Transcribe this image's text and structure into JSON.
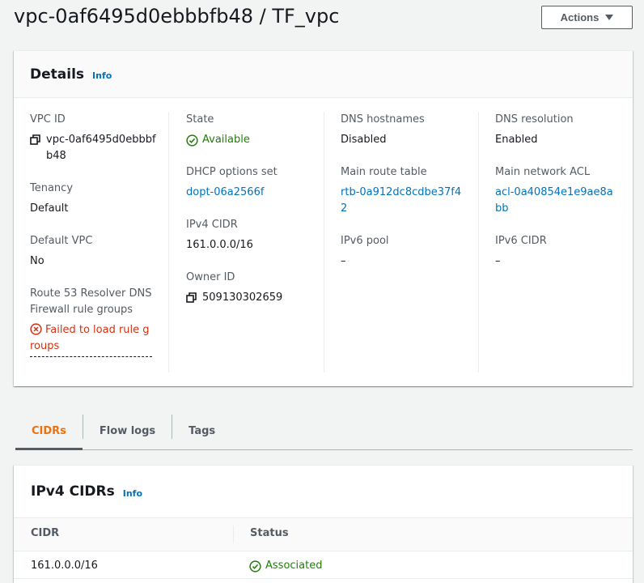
{
  "header": {
    "title": "vpc-0af6495d0ebbbfb48 / TF_vpc",
    "actions_label": "Actions"
  },
  "details": {
    "title": "Details",
    "info_label": "Info",
    "col1": {
      "vpc_id_label": "VPC ID",
      "vpc_id_value": "vpc-0af6495d0ebbbfb48",
      "tenancy_label": "Tenancy",
      "tenancy_value": "Default",
      "default_vpc_label": "Default VPC",
      "default_vpc_value": "No",
      "resolver_label": "Route 53 Resolver DNS Firewall rule groups",
      "resolver_value": "Failed to load rule groups"
    },
    "col2": {
      "state_label": "State",
      "state_value": "Available",
      "dhcp_label": "DHCP options set",
      "dhcp_value": "dopt-06a2566f",
      "ipv4_label": "IPv4 CIDR",
      "ipv4_value": "161.0.0.0/16",
      "owner_label": "Owner ID",
      "owner_value": "509130302659"
    },
    "col3": {
      "dns_hostnames_label": "DNS hostnames",
      "dns_hostnames_value": "Disabled",
      "route_table_label": "Main route table",
      "route_table_value": "rtb-0a912dc8cdbe37f42",
      "ipv6_pool_label": "IPv6 pool",
      "ipv6_pool_value": "–"
    },
    "col4": {
      "dns_resolution_label": "DNS resolution",
      "dns_resolution_value": "Enabled",
      "acl_label": "Main network ACL",
      "acl_value": "acl-0a40854e1e9ae8abb",
      "ipv6_cidr_label": "IPv6 CIDR",
      "ipv6_cidr_value": "–"
    }
  },
  "tabs": [
    {
      "label": "CIDRs"
    },
    {
      "label": "Flow logs"
    },
    {
      "label": "Tags"
    }
  ],
  "cidrs": {
    "title": "IPv4 CIDRs",
    "info_label": "Info",
    "columns": [
      "CIDR",
      "Status"
    ],
    "rows": [
      {
        "cidr": "161.0.0.0/16",
        "status": "Associated"
      }
    ]
  },
  "colors": {
    "link": "#0073bb",
    "success": "#1d8102",
    "error": "#d13212",
    "active_tab": "#ec7211"
  },
  "icons": {
    "copy": "copy-icon",
    "success": "check-circle-icon",
    "error": "x-circle-icon",
    "caret": "caret-down-icon"
  }
}
